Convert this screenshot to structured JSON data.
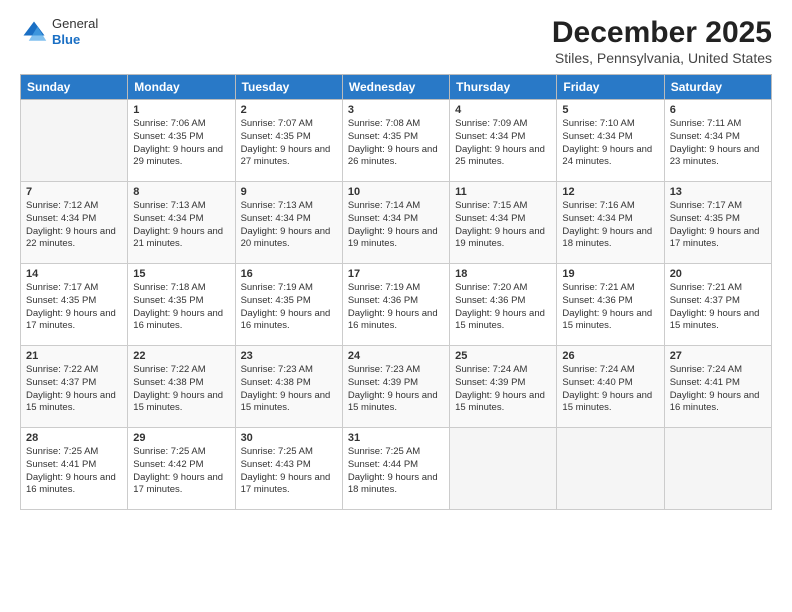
{
  "logo": {
    "general": "General",
    "blue": "Blue"
  },
  "header": {
    "title": "December 2025",
    "subtitle": "Stiles, Pennsylvania, United States"
  },
  "weekdays": [
    "Sunday",
    "Monday",
    "Tuesday",
    "Wednesday",
    "Thursday",
    "Friday",
    "Saturday"
  ],
  "weeks": [
    [
      {
        "day": "",
        "sunrise": "",
        "sunset": "",
        "daylight": ""
      },
      {
        "day": "1",
        "sunrise": "Sunrise: 7:06 AM",
        "sunset": "Sunset: 4:35 PM",
        "daylight": "Daylight: 9 hours and 29 minutes."
      },
      {
        "day": "2",
        "sunrise": "Sunrise: 7:07 AM",
        "sunset": "Sunset: 4:35 PM",
        "daylight": "Daylight: 9 hours and 27 minutes."
      },
      {
        "day": "3",
        "sunrise": "Sunrise: 7:08 AM",
        "sunset": "Sunset: 4:35 PM",
        "daylight": "Daylight: 9 hours and 26 minutes."
      },
      {
        "day": "4",
        "sunrise": "Sunrise: 7:09 AM",
        "sunset": "Sunset: 4:34 PM",
        "daylight": "Daylight: 9 hours and 25 minutes."
      },
      {
        "day": "5",
        "sunrise": "Sunrise: 7:10 AM",
        "sunset": "Sunset: 4:34 PM",
        "daylight": "Daylight: 9 hours and 24 minutes."
      },
      {
        "day": "6",
        "sunrise": "Sunrise: 7:11 AM",
        "sunset": "Sunset: 4:34 PM",
        "daylight": "Daylight: 9 hours and 23 minutes."
      }
    ],
    [
      {
        "day": "7",
        "sunrise": "Sunrise: 7:12 AM",
        "sunset": "Sunset: 4:34 PM",
        "daylight": "Daylight: 9 hours and 22 minutes."
      },
      {
        "day": "8",
        "sunrise": "Sunrise: 7:13 AM",
        "sunset": "Sunset: 4:34 PM",
        "daylight": "Daylight: 9 hours and 21 minutes."
      },
      {
        "day": "9",
        "sunrise": "Sunrise: 7:13 AM",
        "sunset": "Sunset: 4:34 PM",
        "daylight": "Daylight: 9 hours and 20 minutes."
      },
      {
        "day": "10",
        "sunrise": "Sunrise: 7:14 AM",
        "sunset": "Sunset: 4:34 PM",
        "daylight": "Daylight: 9 hours and 19 minutes."
      },
      {
        "day": "11",
        "sunrise": "Sunrise: 7:15 AM",
        "sunset": "Sunset: 4:34 PM",
        "daylight": "Daylight: 9 hours and 19 minutes."
      },
      {
        "day": "12",
        "sunrise": "Sunrise: 7:16 AM",
        "sunset": "Sunset: 4:34 PM",
        "daylight": "Daylight: 9 hours and 18 minutes."
      },
      {
        "day": "13",
        "sunrise": "Sunrise: 7:17 AM",
        "sunset": "Sunset: 4:35 PM",
        "daylight": "Daylight: 9 hours and 17 minutes."
      }
    ],
    [
      {
        "day": "14",
        "sunrise": "Sunrise: 7:17 AM",
        "sunset": "Sunset: 4:35 PM",
        "daylight": "Daylight: 9 hours and 17 minutes."
      },
      {
        "day": "15",
        "sunrise": "Sunrise: 7:18 AM",
        "sunset": "Sunset: 4:35 PM",
        "daylight": "Daylight: 9 hours and 16 minutes."
      },
      {
        "day": "16",
        "sunrise": "Sunrise: 7:19 AM",
        "sunset": "Sunset: 4:35 PM",
        "daylight": "Daylight: 9 hours and 16 minutes."
      },
      {
        "day": "17",
        "sunrise": "Sunrise: 7:19 AM",
        "sunset": "Sunset: 4:36 PM",
        "daylight": "Daylight: 9 hours and 16 minutes."
      },
      {
        "day": "18",
        "sunrise": "Sunrise: 7:20 AM",
        "sunset": "Sunset: 4:36 PM",
        "daylight": "Daylight: 9 hours and 15 minutes."
      },
      {
        "day": "19",
        "sunrise": "Sunrise: 7:21 AM",
        "sunset": "Sunset: 4:36 PM",
        "daylight": "Daylight: 9 hours and 15 minutes."
      },
      {
        "day": "20",
        "sunrise": "Sunrise: 7:21 AM",
        "sunset": "Sunset: 4:37 PM",
        "daylight": "Daylight: 9 hours and 15 minutes."
      }
    ],
    [
      {
        "day": "21",
        "sunrise": "Sunrise: 7:22 AM",
        "sunset": "Sunset: 4:37 PM",
        "daylight": "Daylight: 9 hours and 15 minutes."
      },
      {
        "day": "22",
        "sunrise": "Sunrise: 7:22 AM",
        "sunset": "Sunset: 4:38 PM",
        "daylight": "Daylight: 9 hours and 15 minutes."
      },
      {
        "day": "23",
        "sunrise": "Sunrise: 7:23 AM",
        "sunset": "Sunset: 4:38 PM",
        "daylight": "Daylight: 9 hours and 15 minutes."
      },
      {
        "day": "24",
        "sunrise": "Sunrise: 7:23 AM",
        "sunset": "Sunset: 4:39 PM",
        "daylight": "Daylight: 9 hours and 15 minutes."
      },
      {
        "day": "25",
        "sunrise": "Sunrise: 7:24 AM",
        "sunset": "Sunset: 4:39 PM",
        "daylight": "Daylight: 9 hours and 15 minutes."
      },
      {
        "day": "26",
        "sunrise": "Sunrise: 7:24 AM",
        "sunset": "Sunset: 4:40 PM",
        "daylight": "Daylight: 9 hours and 15 minutes."
      },
      {
        "day": "27",
        "sunrise": "Sunrise: 7:24 AM",
        "sunset": "Sunset: 4:41 PM",
        "daylight": "Daylight: 9 hours and 16 minutes."
      }
    ],
    [
      {
        "day": "28",
        "sunrise": "Sunrise: 7:25 AM",
        "sunset": "Sunset: 4:41 PM",
        "daylight": "Daylight: 9 hours and 16 minutes."
      },
      {
        "day": "29",
        "sunrise": "Sunrise: 7:25 AM",
        "sunset": "Sunset: 4:42 PM",
        "daylight": "Daylight: 9 hours and 17 minutes."
      },
      {
        "day": "30",
        "sunrise": "Sunrise: 7:25 AM",
        "sunset": "Sunset: 4:43 PM",
        "daylight": "Daylight: 9 hours and 17 minutes."
      },
      {
        "day": "31",
        "sunrise": "Sunrise: 7:25 AM",
        "sunset": "Sunset: 4:44 PM",
        "daylight": "Daylight: 9 hours and 18 minutes."
      },
      {
        "day": "",
        "sunrise": "",
        "sunset": "",
        "daylight": ""
      },
      {
        "day": "",
        "sunrise": "",
        "sunset": "",
        "daylight": ""
      },
      {
        "day": "",
        "sunrise": "",
        "sunset": "",
        "daylight": ""
      }
    ]
  ]
}
